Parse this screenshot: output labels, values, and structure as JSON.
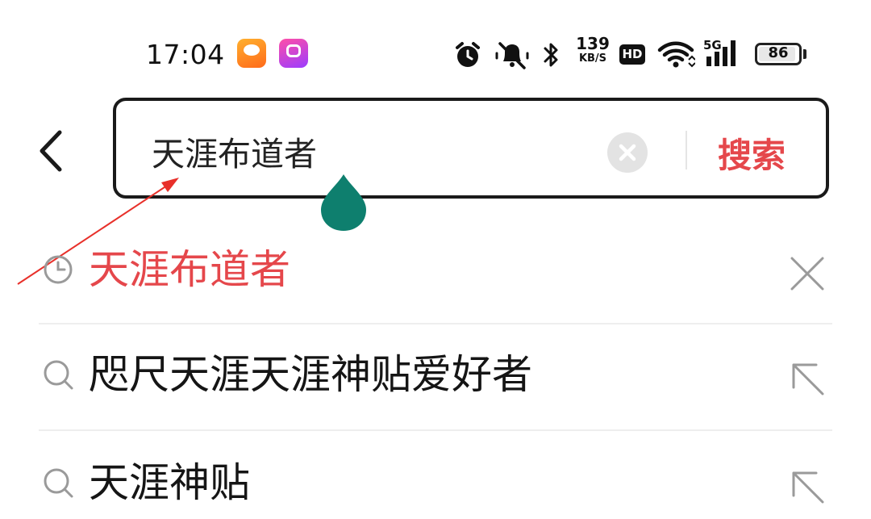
{
  "status_bar": {
    "time": "17:04",
    "app_badges": [
      {
        "icon": "weibo-app-icon",
        "color": "#ff8a1f"
      },
      {
        "icon": "kuaishou-app-icon",
        "color": "#c33cff"
      }
    ],
    "icons": [
      "alarm-icon",
      "mute-icon",
      "bluetooth-icon",
      "hd-icon",
      "wifi-icon",
      "signal-5g-icon"
    ],
    "net_speed_value": "139",
    "net_speed_unit": "KB/S",
    "hd_label": "HD",
    "network_label": "5G",
    "battery_level": "86"
  },
  "search": {
    "back_icon": "chevron-left-icon",
    "query": "天涯布道者",
    "clear_icon": "clear-circle-icon",
    "submit_label": "搜索",
    "accent_color": "#e5474b"
  },
  "suggestions": [
    {
      "type": "history",
      "icon": "clock-icon",
      "text": "天涯布道者",
      "action_icon": "close-icon"
    },
    {
      "type": "suggest",
      "icon": "search-icon",
      "text": "咫尺天涯天涯神贴爱好者",
      "action_icon": "arrow-up-left-icon"
    },
    {
      "type": "suggest",
      "icon": "search-icon",
      "text": "天涯神贴",
      "action_icon": "arrow-up-left-icon"
    }
  ],
  "colors": {
    "cursor_handle": "#0e7f6e",
    "annotation_arrow": "#e8302a"
  }
}
